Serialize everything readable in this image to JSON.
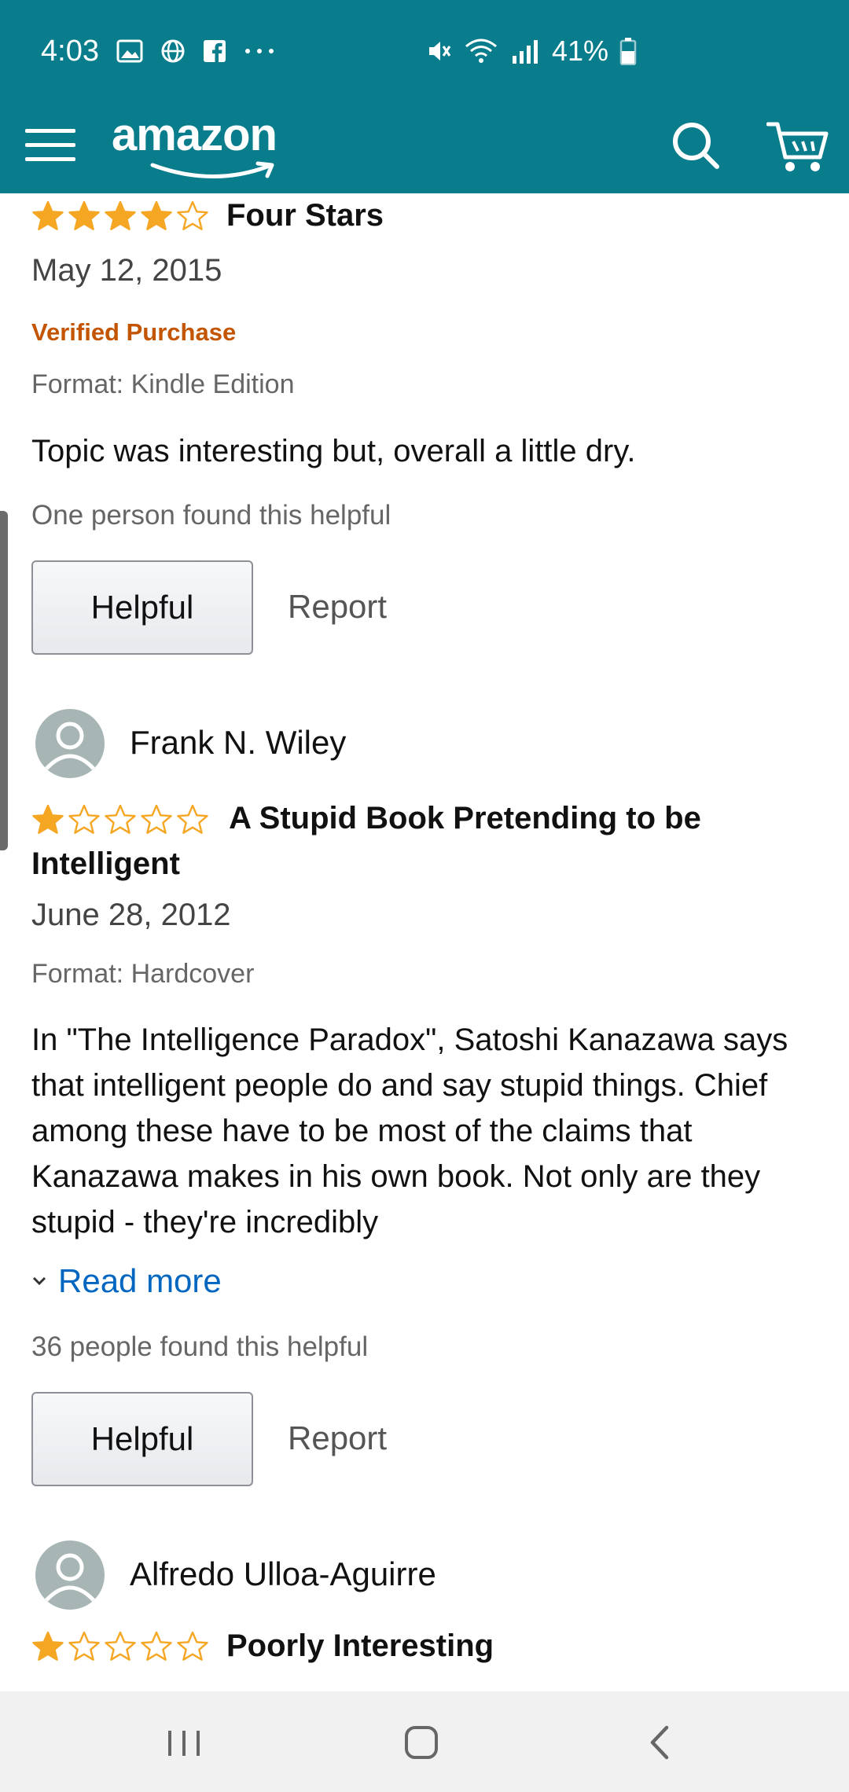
{
  "status_bar": {
    "time": "4:03",
    "battery": "41%",
    "icons": [
      "image-icon",
      "globe-icon",
      "facebook-icon",
      "more-dots-icon",
      "mute-icon",
      "wifi-icon",
      "signal-icon",
      "battery-icon"
    ]
  },
  "app_bar": {
    "logo": "amazon",
    "icons": [
      "menu-icon",
      "search-icon",
      "cart-icon"
    ],
    "color": "#0a7d8c"
  },
  "reviews": [
    {
      "rating": 4,
      "title": "Four Stars",
      "date": "May 12, 2015",
      "verified": "Verified Purchase",
      "format": "Format: Kindle Edition",
      "body": "Topic was interesting but, overall a little dry.",
      "helpful_count": "One person found this helpful",
      "helpful_label": "Helpful",
      "report_label": "Report"
    },
    {
      "reviewer": "Frank N. Wiley",
      "rating": 1,
      "title": "A Stupid Book Pretending to be Intelligent",
      "date": "June 28, 2012",
      "format": "Format: Hardcover",
      "body": "In \"The Intelligence Paradox\", Satoshi Kanazawa says that intelligent people do and say stupid things. Chief among these have to be most of the claims that Kanazawa makes in his own book. Not only are they stupid - they're incredibly",
      "read_more": "Read more",
      "helpful_count": "36 people found this helpful",
      "helpful_label": "Helpful",
      "report_label": "Report"
    },
    {
      "reviewer": "Alfredo Ulloa-Aguirre",
      "rating": 1,
      "title": "Poorly Interesting"
    }
  ],
  "colors": {
    "star": "#f5a623",
    "verified": "#c45500",
    "link": "#0066c0"
  },
  "nav_bar": {
    "icons": [
      "recents-icon",
      "home-icon",
      "back-icon"
    ]
  }
}
